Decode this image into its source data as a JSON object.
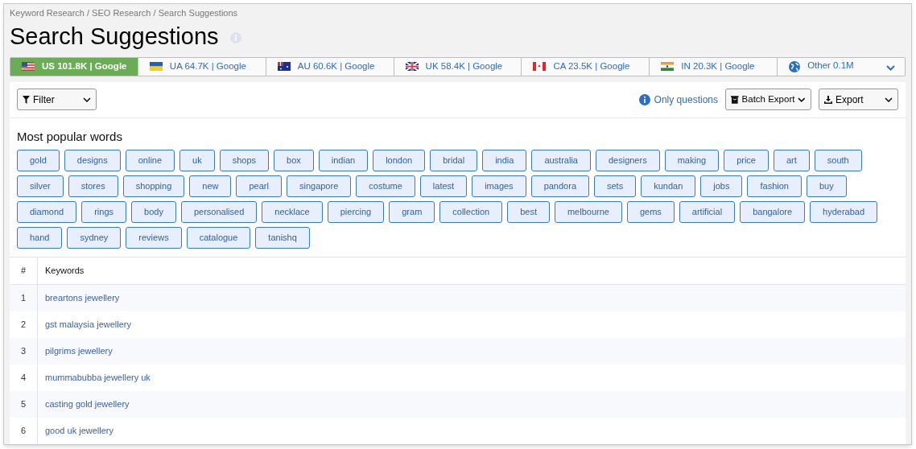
{
  "breadcrumb": "Keyword Research / SEO Research / Search Suggestions",
  "title": "Search Suggestions",
  "tabs": [
    {
      "kind": "country",
      "label": "US 101.8K | Google",
      "selected": true
    },
    {
      "kind": "country",
      "label": "UA 64.7K | Google",
      "selected": false
    },
    {
      "kind": "country",
      "label": "AU 60.6K | Google",
      "selected": false
    },
    {
      "kind": "country",
      "label": "UK 58.4K | Google",
      "selected": false
    },
    {
      "kind": "country",
      "label": "CA 23.5K | Google",
      "selected": false
    },
    {
      "kind": "country",
      "label": "IN 20.3K | Google",
      "selected": false
    },
    {
      "kind": "other",
      "label": "Other 0.1M",
      "selected": false
    }
  ],
  "toolbar": {
    "filter": "Filter",
    "only_questions": "Only questions",
    "batch_export": "Batch Export",
    "export": "Export"
  },
  "popular_words": {
    "heading": "Most popular words",
    "words": [
      "gold",
      "designs",
      "online",
      "uk",
      "shops",
      "box",
      "indian",
      "london",
      "bridal",
      "india",
      "australia",
      "designers",
      "making",
      "price",
      "art",
      "south",
      "silver",
      "stores",
      "shopping",
      "new",
      "pearl",
      "singapore",
      "costume",
      "latest",
      "images",
      "pandora",
      "sets",
      "kundan",
      "jobs",
      "fashion",
      "buy",
      "diamond",
      "rings",
      "body",
      "personalised",
      "necklace",
      "piercing",
      "gram",
      "collection",
      "best",
      "melbourne",
      "gems",
      "artificial",
      "bangalore",
      "hyderabad",
      "hand",
      "sydney",
      "reviews",
      "catalogue",
      "tanishq"
    ]
  },
  "table": {
    "columns": [
      "#",
      "Keywords"
    ],
    "rows": [
      [
        "1",
        "breartons jewellery"
      ],
      [
        "2",
        "gst malaysia jewellery"
      ],
      [
        "3",
        "pilgrims jewellery"
      ],
      [
        "4",
        "mummabubba jewellery uk"
      ],
      [
        "5",
        "casting gold jewellery"
      ],
      [
        "6",
        "good uk jewellery"
      ]
    ]
  }
}
